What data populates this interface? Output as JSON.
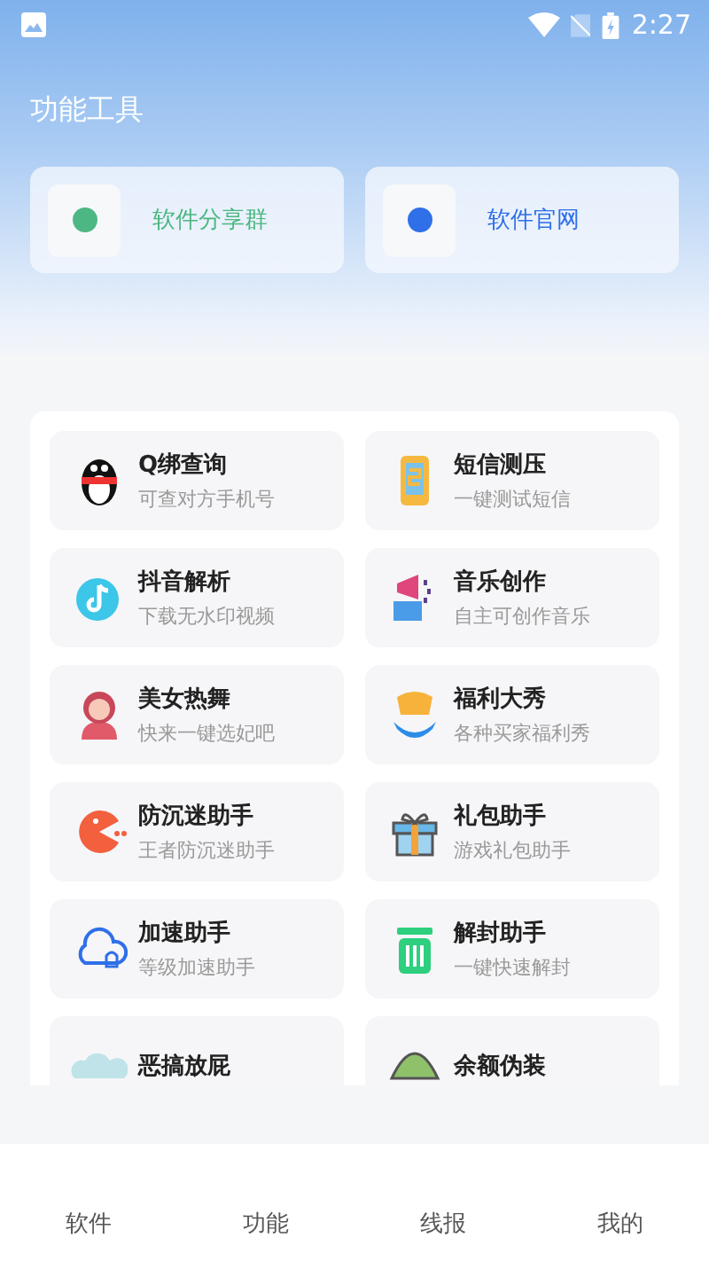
{
  "status_bar": {
    "time": "2:27"
  },
  "header": {
    "title": "功能工具"
  },
  "links": [
    {
      "label": "软件分享群",
      "color": "#4cb782"
    },
    {
      "label": "软件官网",
      "color": "#2f6fe8"
    }
  ],
  "tools": [
    {
      "title": "Q绑查询",
      "subtitle": "可查对方手机号"
    },
    {
      "title": "短信测压",
      "subtitle": "一键测试短信"
    },
    {
      "title": "抖音解析",
      "subtitle": "下载无水印视频"
    },
    {
      "title": "音乐创作",
      "subtitle": "自主可创作音乐"
    },
    {
      "title": "美女热舞",
      "subtitle": "快来一键选妃吧"
    },
    {
      "title": "福利大秀",
      "subtitle": "各种买家福利秀"
    },
    {
      "title": "防沉迷助手",
      "subtitle": "王者防沉迷助手"
    },
    {
      "title": "礼包助手",
      "subtitle": "游戏礼包助手"
    },
    {
      "title": "加速助手",
      "subtitle": "等级加速助手"
    },
    {
      "title": "解封助手",
      "subtitle": "一键快速解封"
    },
    {
      "title": "恶搞放屁"
    },
    {
      "title": "余额伪装"
    }
  ],
  "bottom_nav": [
    {
      "label": "软件"
    },
    {
      "label": "功能"
    },
    {
      "label": "线报"
    },
    {
      "label": "我的"
    }
  ]
}
